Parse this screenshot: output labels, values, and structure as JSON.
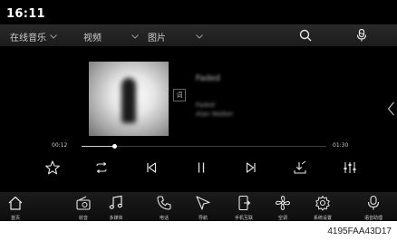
{
  "status": {
    "time": "16:11"
  },
  "source_tabs": [
    {
      "label": "在线音乐"
    },
    {
      "label": "视频"
    },
    {
      "label": "图片"
    }
  ],
  "now_playing": {
    "title": "Faded",
    "artist": "Faded",
    "album": "Alan Walker",
    "lyric_button": "词",
    "elapsed": "00:12",
    "duration": "01:30",
    "progress": 0.133
  },
  "controls": [
    {
      "name": "favorite-icon"
    },
    {
      "name": "repeat-icon"
    },
    {
      "name": "previous-icon"
    },
    {
      "name": "pause-icon"
    },
    {
      "name": "next-icon"
    },
    {
      "name": "download-icon"
    },
    {
      "name": "equalizer-icon"
    }
  ],
  "dock": [
    {
      "icon": "home-icon",
      "label": "首页"
    },
    {
      "icon": "radio-icon",
      "label": "收音"
    },
    {
      "icon": "music-note-icon",
      "label": "多媒体"
    },
    {
      "icon": "phone-icon",
      "label": "电话"
    },
    {
      "icon": "navigation-icon",
      "label": "导航"
    },
    {
      "icon": "phone-link-icon",
      "label": "手机互联"
    },
    {
      "icon": "fan-icon",
      "label": "空调"
    },
    {
      "icon": "gear-icon",
      "label": "系统设置"
    },
    {
      "icon": "microphone-icon",
      "label": "语音助理"
    }
  ],
  "caption": "4195FAA43D17"
}
